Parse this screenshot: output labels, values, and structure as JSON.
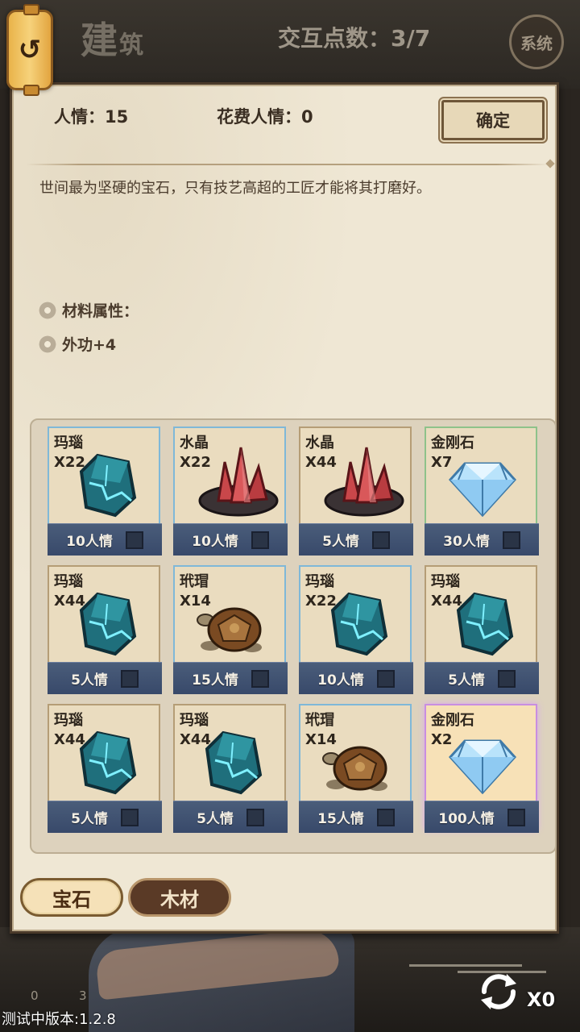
{
  "header": {
    "title_big": "建",
    "title_small": "筑",
    "interaction_points": "交互点数：3/7",
    "system_label": "系统",
    "back_glyph": "↺"
  },
  "panel": {
    "renqing_label": "人情：15",
    "cost_label": "花费人情：0",
    "confirm_label": "确定",
    "description": "世间最为坚硬的宝石，只有技艺高超的工匠才能将其打磨好。",
    "attr_title": "材料属性：",
    "attr_value": "外功+4"
  },
  "items": [
    {
      "name": "玛瑙",
      "qty": "X22",
      "cost": "10人情",
      "icon": "agate-gem-icon",
      "rarity": "rare"
    },
    {
      "name": "水晶",
      "qty": "X22",
      "cost": "10人情",
      "icon": "red-crystal-icon",
      "rarity": "rare"
    },
    {
      "name": "水晶",
      "qty": "X44",
      "cost": "5人情",
      "icon": "red-crystal-icon",
      "rarity": "common"
    },
    {
      "name": "金刚石",
      "qty": "X7",
      "cost": "30人情",
      "icon": "diamond-icon",
      "rarity": "green"
    },
    {
      "name": "玛瑙",
      "qty": "X44",
      "cost": "5人情",
      "icon": "agate-gem-icon",
      "rarity": "common"
    },
    {
      "name": "玳瑁",
      "qty": "X14",
      "cost": "15人情",
      "icon": "turtle-shell-icon",
      "rarity": "rare"
    },
    {
      "name": "玛瑙",
      "qty": "X22",
      "cost": "10人情",
      "icon": "agate-gem-icon",
      "rarity": "rare"
    },
    {
      "name": "玛瑙",
      "qty": "X44",
      "cost": "5人情",
      "icon": "agate-gem-icon",
      "rarity": "common"
    },
    {
      "name": "玛瑙",
      "qty": "X44",
      "cost": "5人情",
      "icon": "agate-gem-icon",
      "rarity": "common"
    },
    {
      "name": "玛瑙",
      "qty": "X44",
      "cost": "5人情",
      "icon": "agate-gem-icon",
      "rarity": "common"
    },
    {
      "name": "玳瑁",
      "qty": "X14",
      "cost": "15人情",
      "icon": "turtle-shell-icon",
      "rarity": "rare"
    },
    {
      "name": "金刚石",
      "qty": "X2",
      "cost": "100人情",
      "icon": "diamond-icon",
      "rarity": "epic"
    }
  ],
  "tabs": [
    {
      "label": "宝石",
      "active": true
    },
    {
      "label": "木材",
      "active": false
    }
  ],
  "footer": {
    "version": "测试中版本:1.2.8",
    "refresh_count": "X0",
    "stat_a": "0",
    "stat_b": "3"
  },
  "colors": {
    "panel_bg": "#efe7d4",
    "cost_bar": "#425677",
    "epic_border": "#c88ee0",
    "tab_active": "#f5e1b8",
    "tab_inactive": "#5a3a26"
  }
}
